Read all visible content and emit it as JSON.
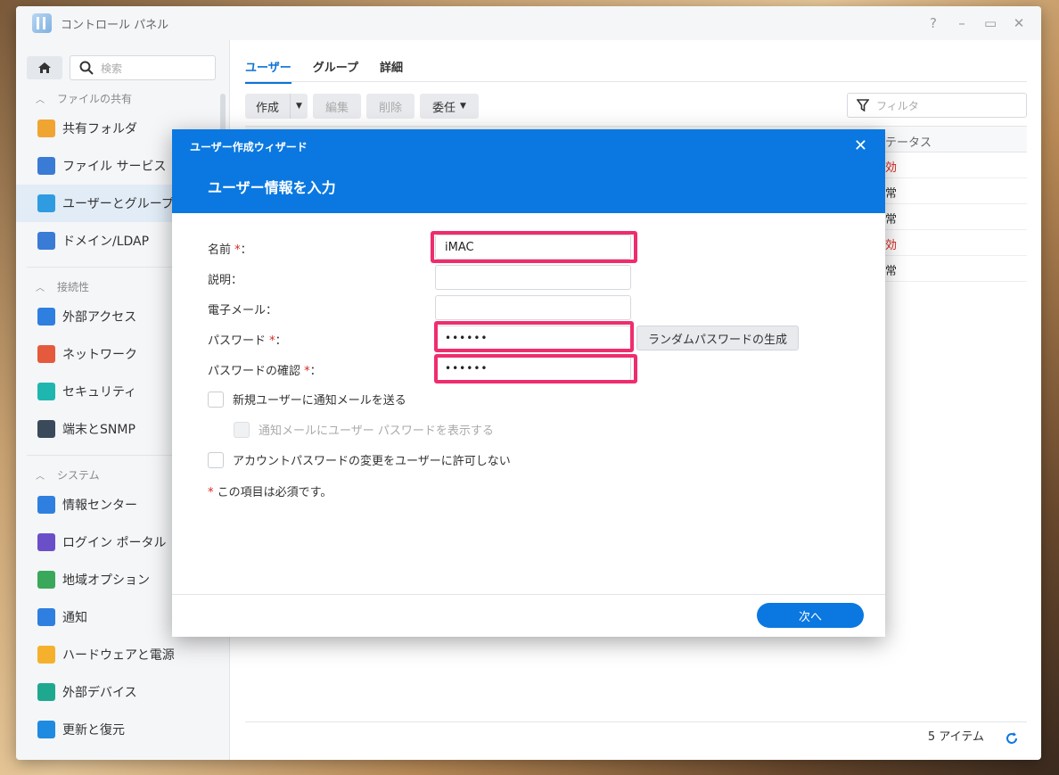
{
  "window": {
    "title": "コントロール パネル",
    "controls": [
      "?",
      "–",
      "▭",
      "✕"
    ]
  },
  "sidebar": {
    "search_placeholder": "検索",
    "sections": [
      {
        "label": "ファイルの共有",
        "items": [
          "共有フォルダ",
          "ファイル サービス",
          "ユーザーとグループ",
          "ドメイン/LDAP"
        ]
      },
      {
        "label": "接続性",
        "items": [
          "外部アクセス",
          "ネットワーク",
          "セキュリティ",
          "端末とSNMP"
        ]
      },
      {
        "label": "システム",
        "items": [
          "情報センター",
          "ログイン ポータル",
          "地域オプション",
          "通知",
          "ハードウェアと電源",
          "外部デバイス",
          "更新と復元"
        ]
      }
    ],
    "item_colors": [
      "#f0a532",
      "#3a7bd5",
      "#2f9be0",
      "#3a7bd5",
      "#2f7fe0",
      "#e55a3c",
      "#1fb6b0",
      "#3a4a5a",
      "#2f7fe0",
      "#6a4fc9",
      "#3aa85a",
      "#2f7fe0",
      "#f5b12e",
      "#1fa890",
      "#1f8be0"
    ]
  },
  "main": {
    "tabs": [
      "ユーザー",
      "グループ",
      "詳細"
    ],
    "toolbar": {
      "create": "作成",
      "edit": "編集",
      "delete": "削除",
      "delegate": "委任"
    },
    "filter_placeholder": "フィルタ",
    "status_header": "テータス",
    "rows": [
      {
        "status": "効",
        "color": "#d9251d"
      },
      {
        "status": "常",
        "color": "#333333"
      },
      {
        "status": "常",
        "color": "#333333"
      },
      {
        "status": "効",
        "color": "#d9251d"
      },
      {
        "status": "常",
        "color": "#333333"
      }
    ],
    "item_count": "5 アイテム"
  },
  "dialog": {
    "title": "ユーザー作成ウィザード",
    "close": "✕",
    "heading": "ユーザー情報を入力",
    "labels": {
      "name": "名前",
      "description": "説明：",
      "email": "電子メール：",
      "password": "パスワード",
      "confirm": "パスワードの確認"
    },
    "required_mark": "*",
    "required_suffix": "：",
    "values": {
      "name": "iMAC",
      "description": "",
      "email": "",
      "password": "••••••",
      "confirm": "••••••"
    },
    "generate_button": "ランダムパスワードの生成",
    "checkboxes": {
      "notify": "新規ユーザーに通知メールを送る",
      "show_password": "通知メールにユーザー パスワードを表示する",
      "disallow_change": "アカウントパスワードの変更をユーザーに許可しない"
    },
    "required_note": "この項目は必須です。",
    "next_button": "次へ",
    "accent": "#0a78e0",
    "highlight": "#ef2d6e"
  }
}
